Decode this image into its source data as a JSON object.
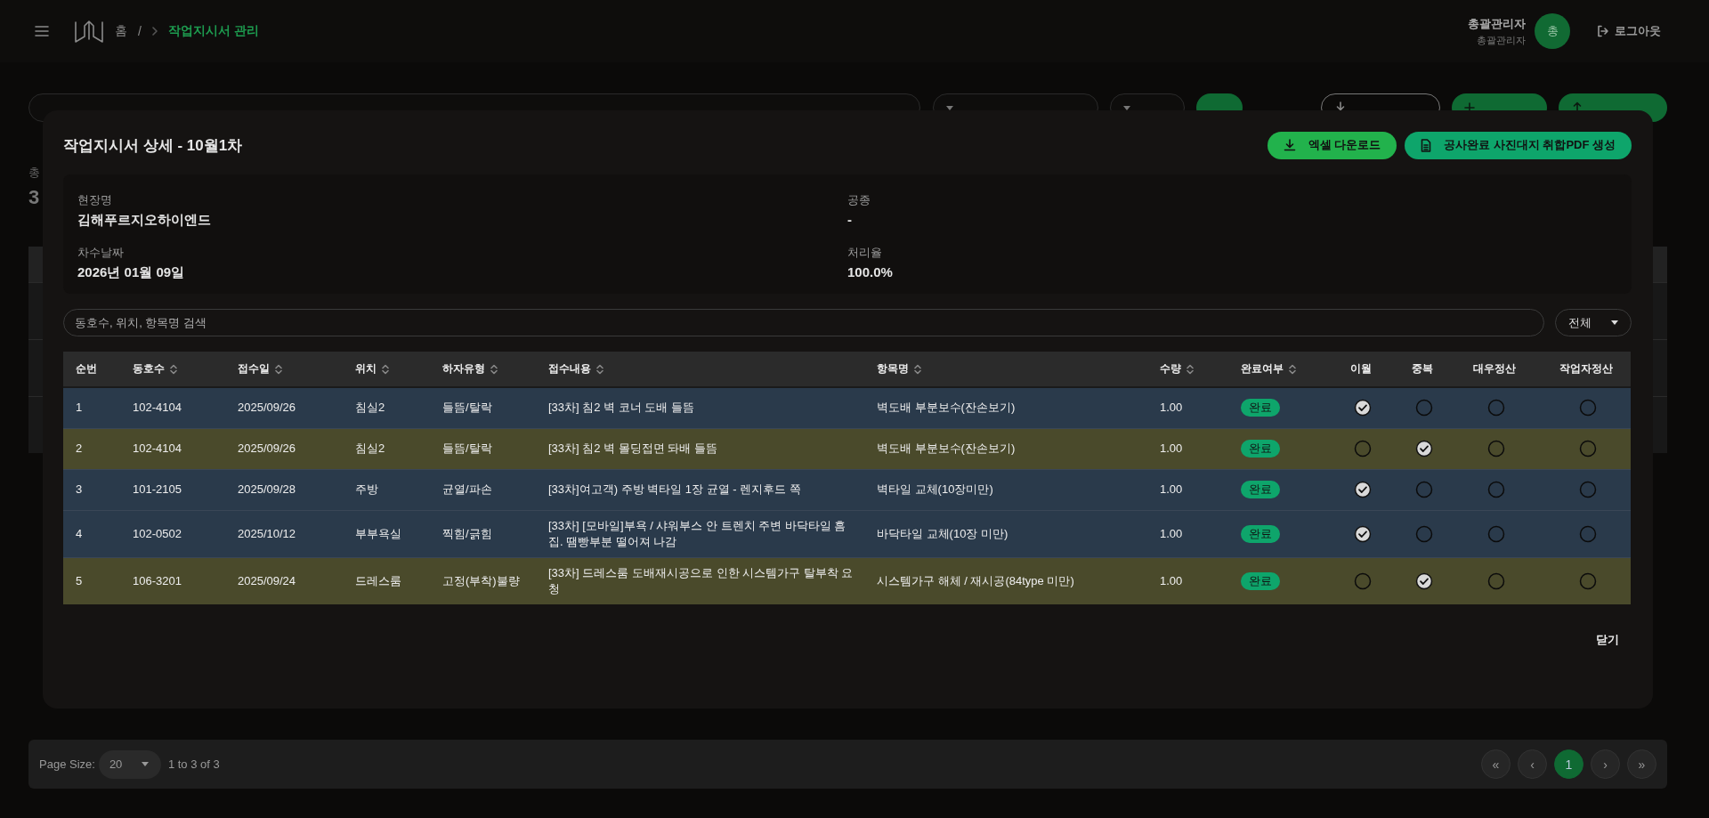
{
  "topbar": {
    "home": "홈",
    "separator": "/",
    "current": "작업지시서 관리",
    "user": {
      "name": "총괄관리자",
      "role": "총괄관리자",
      "avatar": "총"
    },
    "logout": "로그아웃"
  },
  "toolbar": {
    "buttons": [
      {
        "kind": "search"
      },
      {
        "kind": "download"
      },
      {
        "kind": "create"
      },
      {
        "kind": "upload"
      }
    ]
  },
  "summary": {
    "label": "총",
    "value": "3"
  },
  "modal": {
    "title": "작업지시서 상세 - 10월1차",
    "actions": [
      {
        "label": "엑셀 다운로드",
        "kind": "excel"
      },
      {
        "label": "공사완료 사진대지 취합PDF 생성",
        "kind": "pdf"
      }
    ],
    "info": [
      {
        "label": "현장명",
        "value": "김해푸르지오하이엔드"
      },
      {
        "label": "공종",
        "value": "-"
      },
      {
        "label": "차수날짜",
        "value": "2026년 01월 09일"
      },
      {
        "label": "처리율",
        "value": "100.0%"
      }
    ],
    "search": {
      "placeholder": "동호수, 위치, 항목명 검색"
    },
    "filter": "전체",
    "table": {
      "columns": [
        {
          "label": "순번",
          "sortable": false
        },
        {
          "label": "동호수",
          "sortable": true
        },
        {
          "label": "접수일",
          "sortable": true
        },
        {
          "label": "위치",
          "sortable": true
        },
        {
          "label": "하자유형",
          "sortable": true
        },
        {
          "label": "접수내용",
          "sortable": true
        },
        {
          "label": "항목명",
          "sortable": true
        },
        {
          "label": "수량",
          "sortable": true
        },
        {
          "label": "완료여부",
          "sortable": true
        },
        {
          "label": "이월",
          "sortable": false
        },
        {
          "label": "중복",
          "sortable": false
        },
        {
          "label": "대우정산",
          "sortable": false
        },
        {
          "label": "작업자정산",
          "sortable": false
        }
      ],
      "rows": [
        {
          "cells": [
            "1",
            "102-4104",
            "2025/09/26",
            "침실2",
            "들뜸/탈락",
            "[33차] 침2 벽 코너 도배 들뜸",
            "벽도배 부분보수(잔손보기)",
            "1.00"
          ],
          "status": "완료",
          "checks": [
            {
              "checked": true
            },
            {
              "checked": false
            },
            {
              "checked": false
            },
            {
              "checked": false
            }
          ]
        },
        {
          "cells": [
            "2",
            "102-4104",
            "2025/09/26",
            "침실2",
            "들뜸/탈락",
            "[33차] 침2 벽 몰딩접면 돠배 들뜸",
            "벽도배 부분보수(잔손보기)",
            "1.00"
          ],
          "status": "완료",
          "checks": [
            {
              "checked": false
            },
            {
              "checked": true
            },
            {
              "checked": false
            },
            {
              "checked": false
            }
          ]
        },
        {
          "cells": [
            "3",
            "101-2105",
            "2025/09/28",
            "주방",
            "균열/파손",
            "[33차]여고객) 주방 벽타일 1장 균열 - 렌지후드 쪽",
            "벽타일 교체(10장미만)",
            "1.00"
          ],
          "status": "완료",
          "checks": [
            {
              "checked": true
            },
            {
              "checked": false
            },
            {
              "checked": false
            },
            {
              "checked": false
            }
          ]
        },
        {
          "cells": [
            "4",
            "102-0502",
            "2025/10/12",
            "부부욕실",
            "찍힘/긁힘",
            "[33차] [모바일]부욕 / 샤워부스 안 트렌치 주변 바닥타일 흠집. 땜빵부분 떨어져 나감",
            "바닥타일 교체(10장 미만)",
            "1.00"
          ],
          "status": "완료",
          "checks": [
            {
              "checked": true
            },
            {
              "checked": false
            },
            {
              "checked": false
            },
            {
              "checked": false
            }
          ]
        },
        {
          "cells": [
            "5",
            "106-3201",
            "2025/09/24",
            "드레스룸",
            "고정(부착)불량",
            "[33차] 드레스룸 도배재시공으로 인한 시스템가구 탈부착 요청",
            "시스템가구 해체 / 재시공(84type 미만)",
            "1.00"
          ],
          "status": "완료",
          "checks": [
            {
              "checked": false
            },
            {
              "checked": true
            },
            {
              "checked": false
            },
            {
              "checked": false
            }
          ]
        }
      ]
    },
    "close": "닫기"
  },
  "pagination": {
    "page_size_label": "Page Size:",
    "page_size": "20",
    "range": "1 to 3 of 3",
    "first": "«",
    "prev": "‹",
    "pages": [
      {
        "label": "1",
        "selected": true
      }
    ],
    "next": "›",
    "last": "»"
  }
}
